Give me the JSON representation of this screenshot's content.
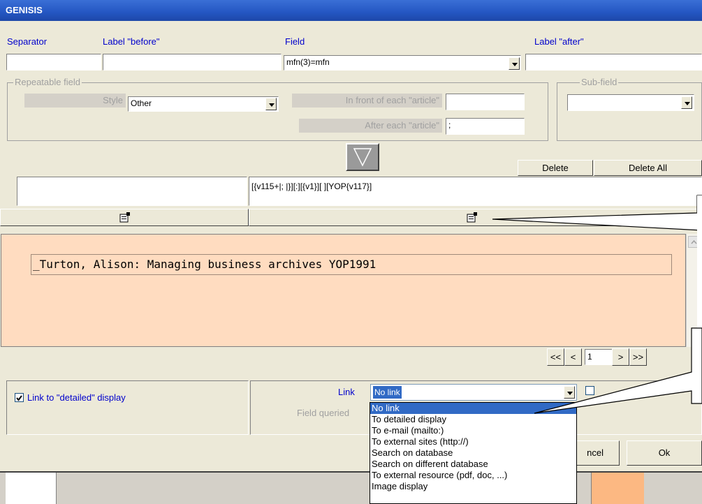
{
  "window": {
    "title": "GENISIS"
  },
  "labels": {
    "separator": "Separator",
    "label_before": "Label \"before\"",
    "field": "Field",
    "label_after": "Label \"after\""
  },
  "field_value": "mfn(3)=mfn",
  "repeatable": {
    "title": "Repeatable field",
    "style_label": "Style",
    "style_value": "Other",
    "in_front_label": "In front of each \"article\"",
    "after_label": "After each \"article\"",
    "after_value": ";"
  },
  "subfield": {
    "title": "Sub-field"
  },
  "actions": {
    "delete": "Delete",
    "delete_all": "Delete All"
  },
  "format_expression": "[{v115+|; |}][:][{v1}][ ][YOP{v117}]",
  "preview_text": "_Turton, Alison: Managing business archives  YOP1991",
  "pager": {
    "first": "<<",
    "prev": "<",
    "page": "1",
    "next": ">",
    "last": ">>"
  },
  "link_detailed": {
    "label": "Link to \"detailed\" display",
    "checked": true
  },
  "link": {
    "label": "Link",
    "value": "No link",
    "field_queried_label": "Field queried",
    "options": [
      "No link",
      "To detailed display",
      "To e-mail (mailto:)",
      "To external sites (http://)",
      "Search on database",
      "Search on different database",
      "To external resource (pdf, doc, ...)",
      "Image display"
    ]
  },
  "dialog": {
    "cancel": "ncel",
    "ok": "Ok"
  },
  "colors": {
    "preview_bg": "#ffdcc0",
    "title_bar": "#2456c2",
    "selection": "#316ac5"
  }
}
